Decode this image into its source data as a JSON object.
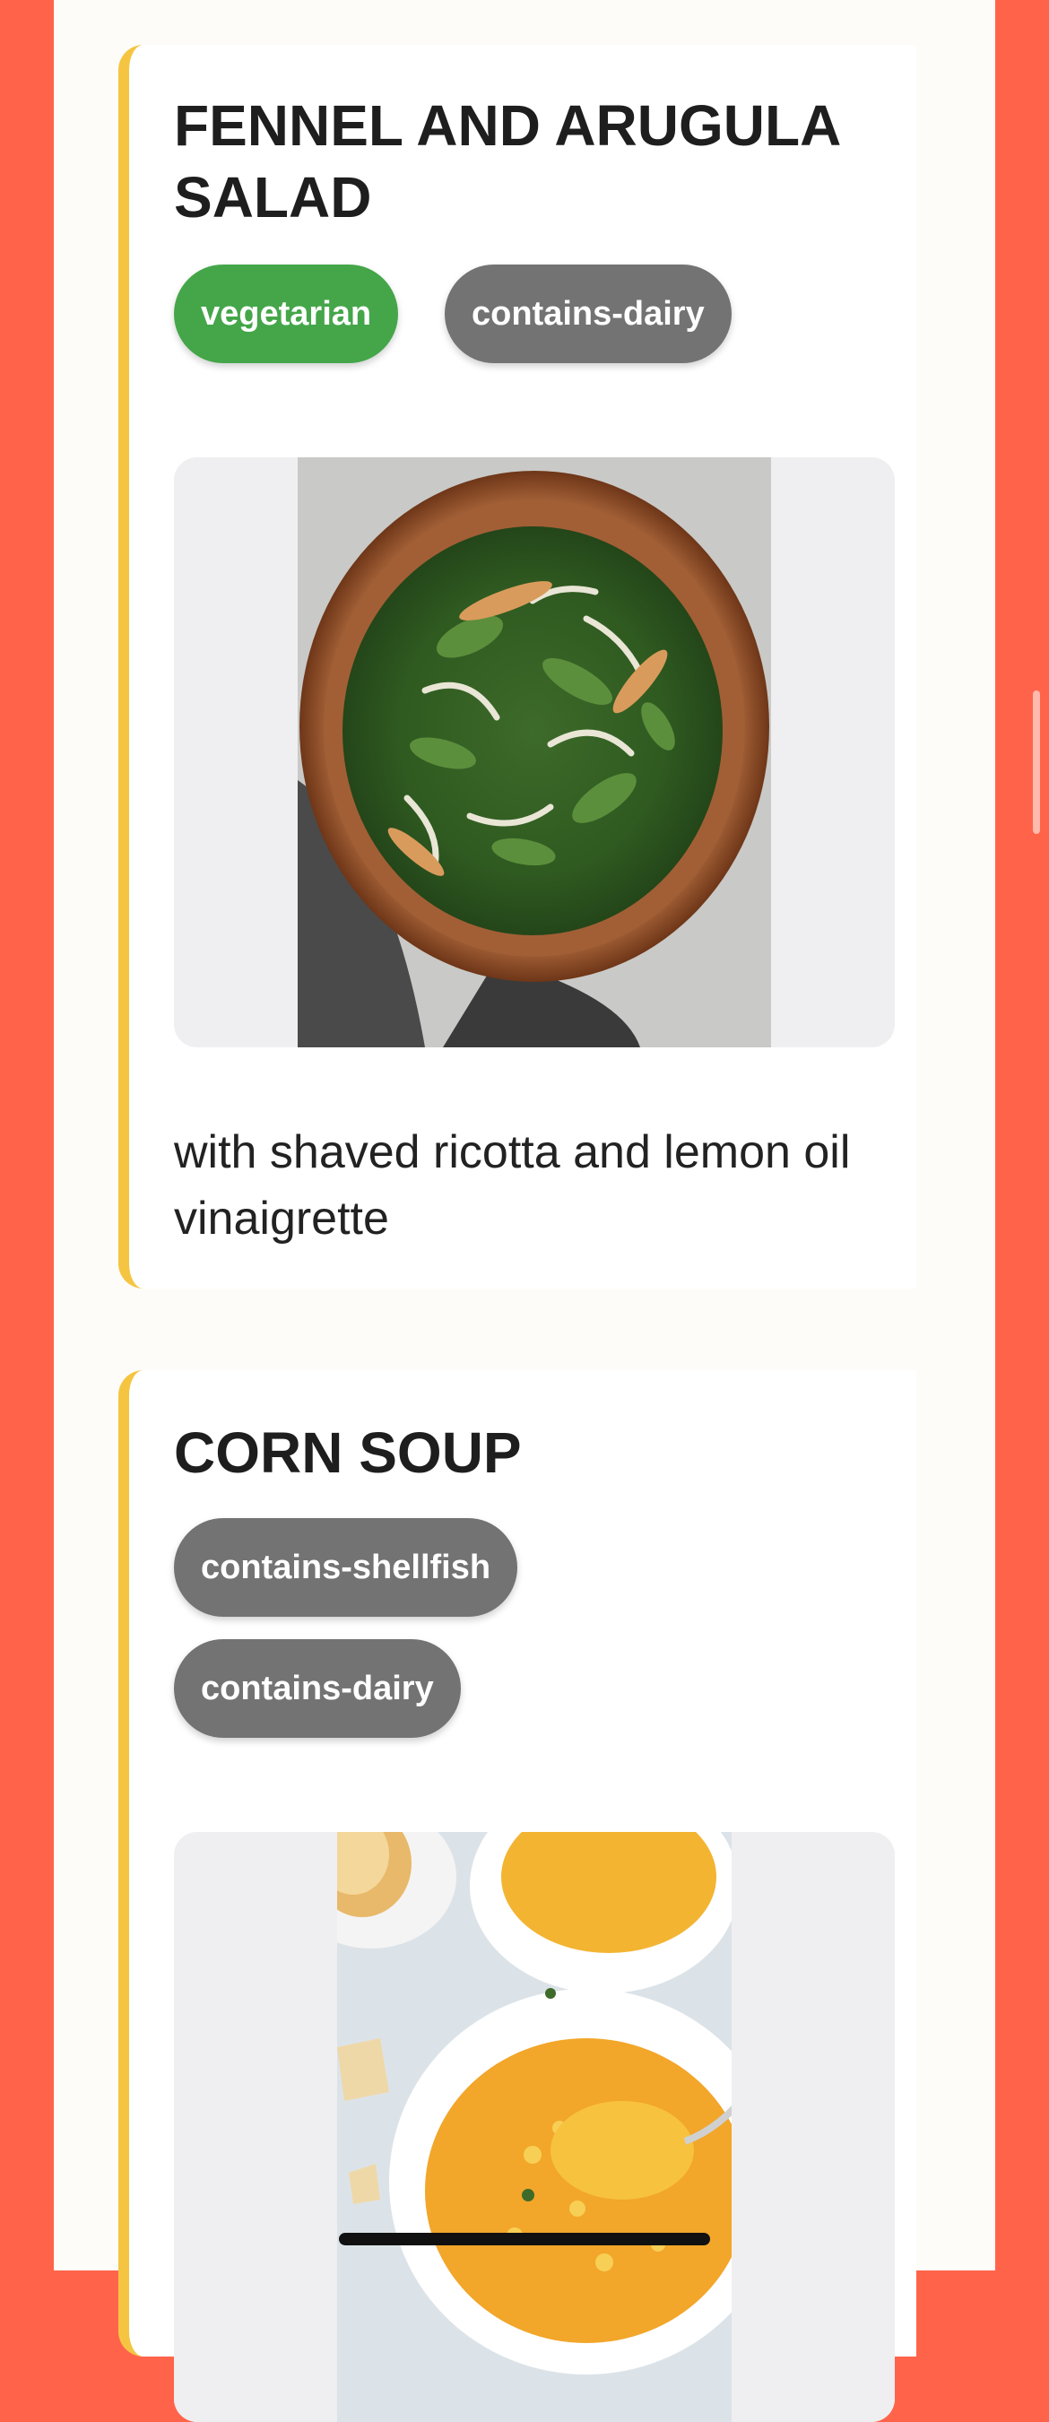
{
  "recipes": [
    {
      "title": "FENNEL AND ARUGULA SALAD",
      "tags": [
        {
          "label": "vegetarian",
          "color": "#44A649"
        },
        {
          "label": "contains-dairy",
          "color": "#737373"
        }
      ],
      "image": "salad-bowl-image",
      "description": "with shaved ricotta and lemon oil vinaigrette"
    },
    {
      "title": "CORN SOUP",
      "tags": [
        {
          "label": "contains-shellfish",
          "color": "#737373"
        },
        {
          "label": "contains-dairy",
          "color": "#737373"
        }
      ],
      "image": "corn-soup-image"
    }
  ],
  "colors": {
    "background": "#FF644B",
    "page": "#FDFCF9",
    "card_accent": "#F5C542"
  }
}
